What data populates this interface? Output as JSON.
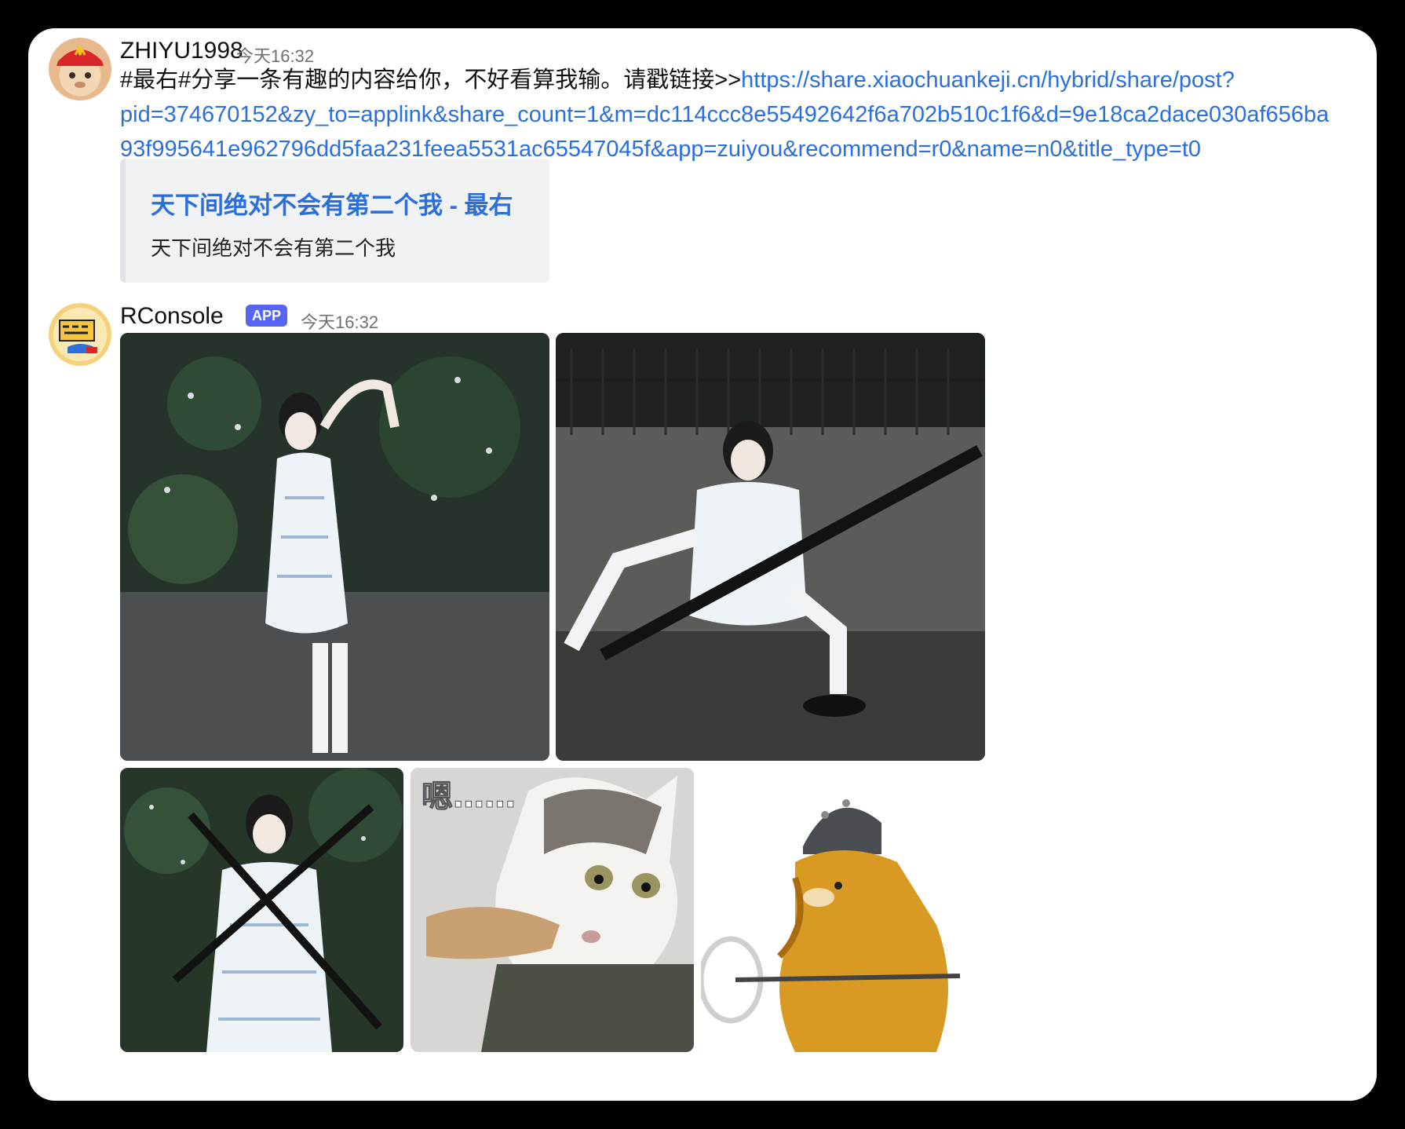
{
  "messages": [
    {
      "username": "ZHIYU1998",
      "timestamp": "今天16:32",
      "text_prefix": "#最右#分享一条有趣的内容给你，不好看算我输。请戳链接>>",
      "link_line1": "https://share.xiaochuankeji.cn/hybrid/share/post?",
      "link_line2": "pid=374670152&zy_to=applink&share_count=1&m=dc114ccc8e55492642f6a702b510c1f6&d=9e18ca2dace030af656ba",
      "link_line3": "93f995641e962796dd5faa231feea5531ac65547045f&app=zuiyou&recommend=r0&name=n0&title_type=t0",
      "embed": {
        "title": "天下间绝对不会有第二个我 - 最右",
        "description": "天下间绝对不会有第二个我"
      }
    },
    {
      "username": "RConsole",
      "badge": "APP",
      "timestamp": "今天16:32",
      "meme_text": "嗯……"
    }
  ]
}
